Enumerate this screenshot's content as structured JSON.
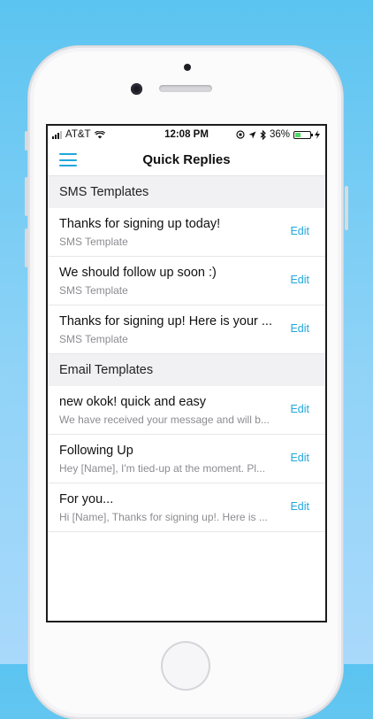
{
  "status_bar": {
    "carrier": "AT&T",
    "time": "12:08 PM",
    "battery_percent": "36%"
  },
  "nav": {
    "title": "Quick Replies",
    "menu_icon": "hamburger-menu-icon"
  },
  "sections": [
    {
      "header": "SMS Templates",
      "items": [
        {
          "title": "Thanks for signing up today!",
          "subtitle": "SMS Template",
          "action": "Edit"
        },
        {
          "title": "We should follow up soon :)",
          "subtitle": "SMS Template",
          "action": "Edit"
        },
        {
          "title": "Thanks for signing up! Here is your ...",
          "subtitle": "SMS Template",
          "action": "Edit"
        }
      ]
    },
    {
      "header": "Email Templates",
      "items": [
        {
          "title": "new okok! quick and easy",
          "subtitle": "We have received your message and will b...",
          "action": "Edit"
        },
        {
          "title": "Following Up",
          "subtitle": "Hey [Name], I'm tied-up at the moment. Pl...",
          "action": "Edit"
        },
        {
          "title": "For you...",
          "subtitle": "Hi [Name], Thanks for signing up!. Here is ...",
          "action": "Edit"
        }
      ]
    }
  ],
  "colors": {
    "accent": "#21a7dc",
    "section_bg": "#f1f1f3",
    "background_top": "#5bc4f0",
    "background_bottom": "#a9d9fb"
  }
}
